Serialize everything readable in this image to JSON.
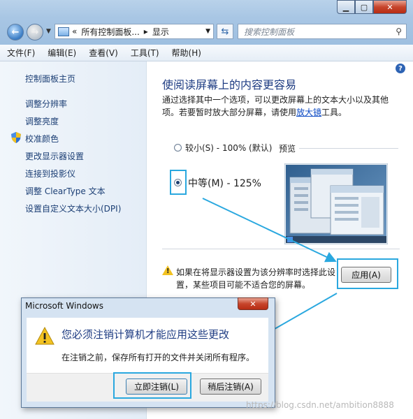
{
  "window": {
    "address_root": "«",
    "address_part1": "所有控制面板...",
    "address_sep": "▸",
    "address_part2": "显示",
    "search_placeholder": "搜索控制面板"
  },
  "menu": [
    "文件(F)",
    "编辑(E)",
    "查看(V)",
    "工具(T)",
    "帮助(H)"
  ],
  "sidebar": {
    "home": "控制面板主页",
    "items": [
      "调整分辨率",
      "调整亮度",
      "校准颜色",
      "更改显示器设置",
      "连接到投影仪",
      "调整 ClearType 文本",
      "设置自定义文本大小(DPI)"
    ]
  },
  "content": {
    "heading": "使阅读屏幕上的内容更容易",
    "desc_part1": "通过选择其中一个选项，可以更改屏幕上的文本大小以及其他项。若要暂时放大部分屏幕，请使用",
    "desc_link": "放大镜",
    "desc_part2": "工具。",
    "options": [
      {
        "label": "较小(S) - 100% (默认)",
        "checked": false
      },
      {
        "label": "中等(M) - 125%",
        "checked": true
      }
    ],
    "preview_label": "预览",
    "warning_line1": "如果在将显示器设置为该分辨率时选择此设",
    "warning_line2": "置，某些项目可能不适合您的屏幕。",
    "apply_button": "应用(A)"
  },
  "dialog": {
    "title": "Microsoft Windows",
    "close": "✕",
    "heading": "您必须注销计算机才能应用这些更改",
    "text": "在注销之前，保存所有打开的文件并关闭所有程序。",
    "logoff_now_button": "立即注销(L)",
    "logoff_later_button": "稍后注销(A)"
  },
  "watermark": "https://blog.csdn.net/ambition8888",
  "colors": {
    "highlight": "#2aa8df",
    "link": "#1c3f75",
    "heading": "#1f3d83"
  }
}
